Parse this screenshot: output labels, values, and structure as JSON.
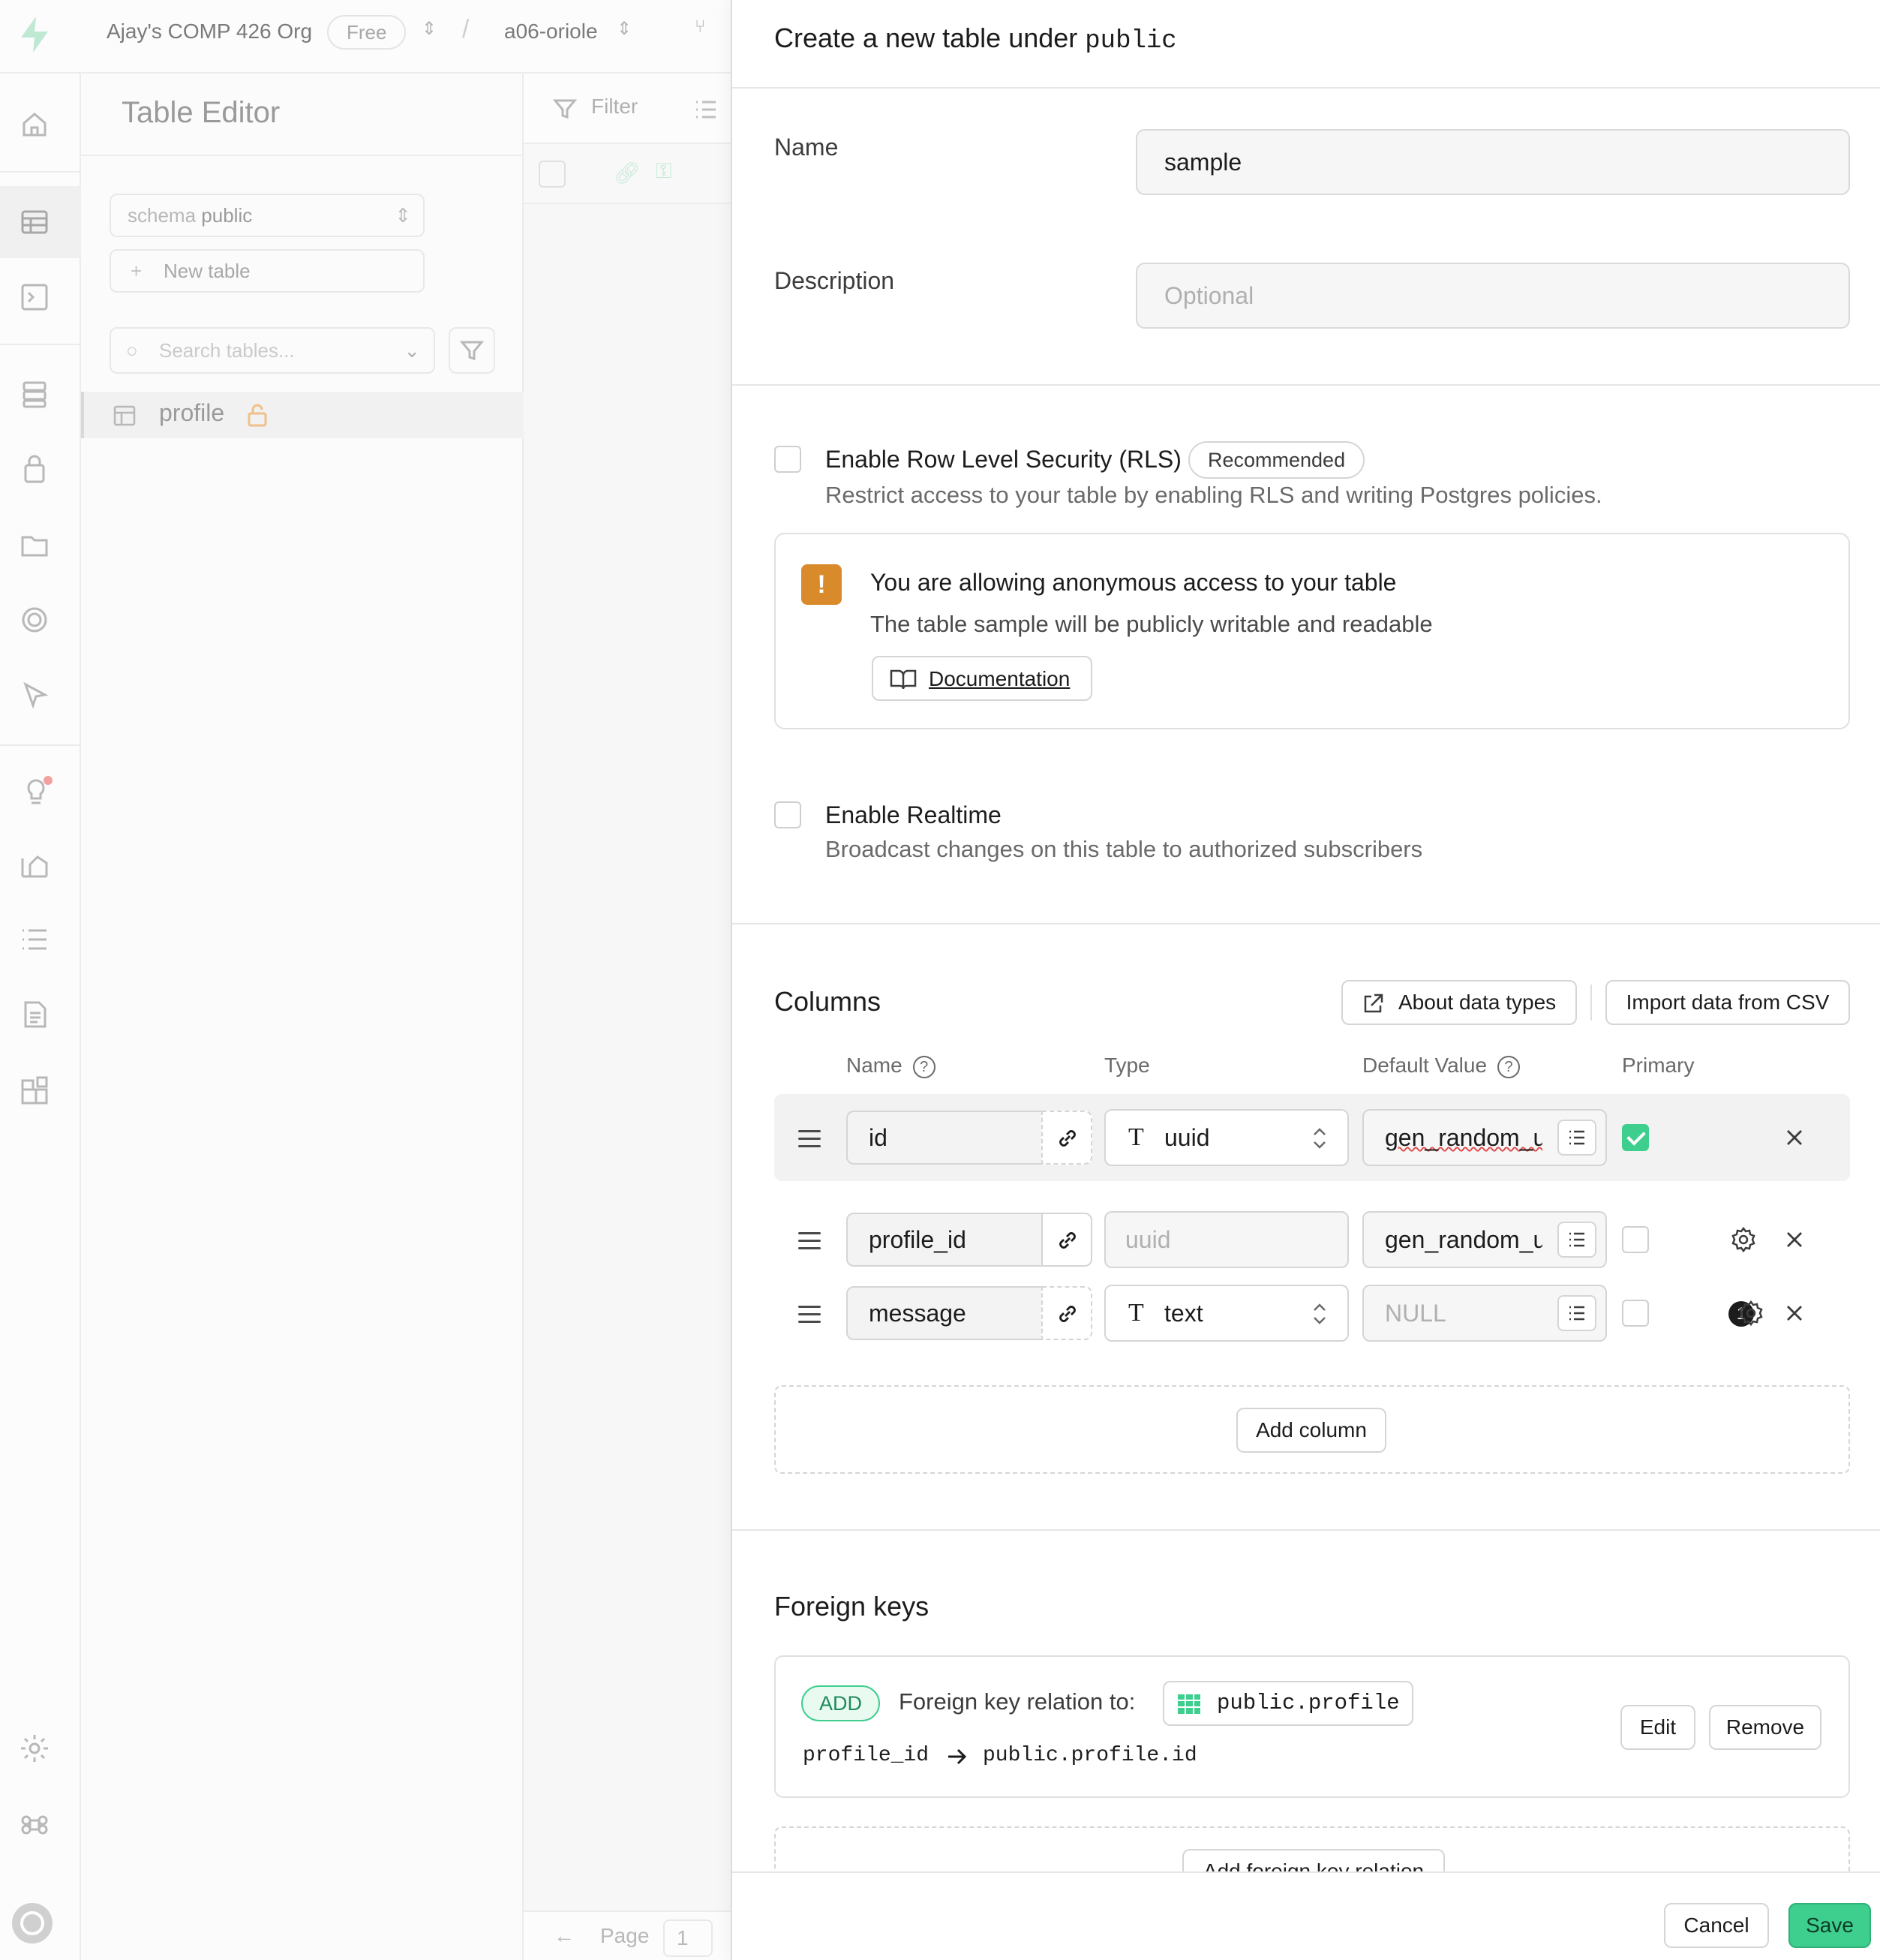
{
  "background": {
    "org_name": "Ajay's COMP 426 Org",
    "plan_badge": "Free",
    "breadcrumb_sep": "/",
    "project_name": "a06-oriole",
    "sidepanel_title": "Table Editor",
    "schema_prefix": "schema",
    "schema_value": "public",
    "new_table_label": "New table",
    "search_placeholder": "Search tables...",
    "tables": [
      "profile"
    ],
    "grid_filter_label": "Filter",
    "page_label": "Page",
    "page_value": "1"
  },
  "sheet": {
    "title_prefix": "Create a new table under",
    "title_schema": "public",
    "name_label": "Name",
    "name_value": "sample",
    "description_label": "Description",
    "description_placeholder": "Optional",
    "rls_title": "Enable Row Level Security (RLS)",
    "rls_badge": "Recommended",
    "rls_desc": "Restrict access to your table by enabling RLS and writing Postgres policies.",
    "rls_checked": false,
    "warning_title": "You are allowing anonymous access to your table",
    "warning_desc": "The table sample will be publicly writable and readable",
    "warning_button": "Documentation",
    "realtime_title": "Enable Realtime",
    "realtime_desc": "Broadcast changes on this table to authorized subscribers",
    "realtime_checked": false,
    "columns_title": "Columns",
    "about_types_btn": "About data types",
    "import_csv_btn": "Import data from CSV",
    "col_headers": {
      "name": "Name",
      "type": "Type",
      "default": "Default Value",
      "primary": "Primary"
    },
    "columns": [
      {
        "name": "id",
        "type": "uuid",
        "type_icon": "T",
        "default": "gen_random_uuid()",
        "primary": true,
        "type_disabled": false
      },
      {
        "name": "profile_id",
        "type": "uuid",
        "type_icon": "",
        "default": "gen_random_uuid()",
        "primary": false,
        "type_disabled": true
      },
      {
        "name": "message",
        "type": "text",
        "type_icon": "T",
        "default": "NULL",
        "primary": false,
        "type_disabled": false,
        "settings_count": "1"
      }
    ],
    "add_column_btn": "Add column",
    "fk_title": "Foreign keys",
    "fk_badge": "ADD",
    "fk_label": "Foreign key relation to:",
    "fk_target": "public.profile",
    "fk_source_col": "profile_id",
    "fk_target_col": "public.profile.id",
    "fk_edit_btn": "Edit",
    "fk_remove_btn": "Remove",
    "add_fk_btn": "Add foreign key relation",
    "cancel_btn": "Cancel",
    "save_btn": "Save"
  },
  "colors": {
    "accent": "#3ecf8e",
    "warning": "#d98a2b"
  }
}
